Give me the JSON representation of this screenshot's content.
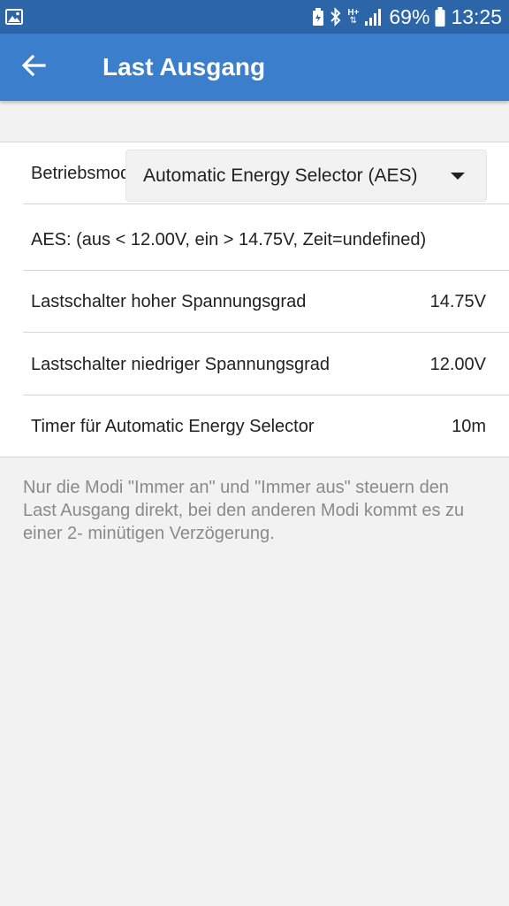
{
  "status_bar": {
    "battery_percent": "69%",
    "time": "13:25",
    "network_label": "H+",
    "icons": [
      "gallery-icon",
      "battery-saver-icon",
      "bluetooth-icon",
      "signal-icon",
      "battery-icon"
    ]
  },
  "app_bar": {
    "title": "Last Ausgang",
    "back_icon": "arrow-left-icon"
  },
  "settings": {
    "mode_label": "Betriebsmodus",
    "mode_value": "Automatic Energy Selector (AES)",
    "aes_info": "AES: (aus < 12.00V, ein > 14.75V, Zeit=undefined)",
    "rows": [
      {
        "label": "Lastschalter hoher Spannungsgrad",
        "value": "14.75V"
      },
      {
        "label": "Lastschalter niedriger Spannungsgrad",
        "value": "12.00V"
      },
      {
        "label": "Timer für Automatic Energy Selector",
        "value": "10m"
      }
    ]
  },
  "note": "Nur die Modi \"Immer an\" und \"Immer aus\" steuern den Last Ausgang direkt, bei den anderen Modi kommt es zu einer 2- minütigen Verzögerung.",
  "colors": {
    "status_bar": "#2c65a8",
    "app_bar": "#3b7fcc",
    "background": "#f2f2f2",
    "card": "#ffffff",
    "note_text": "#8a8a8a"
  }
}
